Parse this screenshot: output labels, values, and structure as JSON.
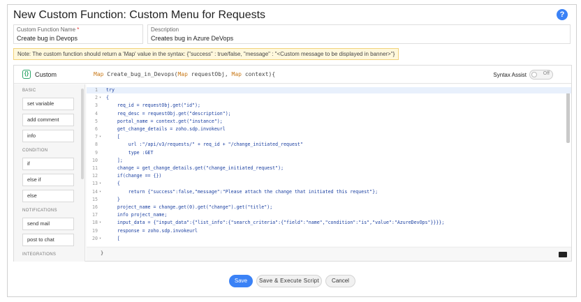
{
  "window": {
    "title": "New Custom Function: Custom Menu for Requests",
    "help_icon": "?"
  },
  "form": {
    "name_label": "Custom Function Name",
    "name_required": "*",
    "name_value": "Create bug in Devops",
    "desc_label": "Description",
    "desc_value": "Creates bug in Azure DeVops"
  },
  "note": "Note: The custom function should return a 'Map' value in the syntax: {\"success\" : true/false, \"message\" : \"<Custom message to be displayed in banner>\"}",
  "editor": {
    "panel_label": "Custom",
    "signature_kw1": "Map",
    "signature_mid": "Create_bug_in_Devops(",
    "signature_kw2": "Map",
    "signature_arg1": "requestObj,",
    "signature_kw3": "Map",
    "signature_arg2": "context){",
    "syntax_assist_label": "Syntax Assist",
    "syntax_toggle": "Off",
    "closing_brace": "}"
  },
  "sidebar": {
    "sections": [
      {
        "label": "BASIC",
        "items": [
          "set variable",
          "add comment",
          "info"
        ]
      },
      {
        "label": "CONDITION",
        "items": [
          "if",
          "else if",
          "else"
        ]
      },
      {
        "label": "NOTIFICATIONS",
        "items": [
          "send mail",
          "post to chat"
        ]
      },
      {
        "label": "INTEGRATIONS",
        "items": []
      }
    ]
  },
  "code": [
    {
      "n": "1",
      "fold": "",
      "text": "try"
    },
    {
      "n": "2",
      "fold": "▾",
      "text": "{"
    },
    {
      "n": "3",
      "fold": "",
      "text": "    req_id = requestObj.get(\"id\");"
    },
    {
      "n": "4",
      "fold": "",
      "text": "    req_desc = requestObj.get(\"description\");"
    },
    {
      "n": "5",
      "fold": "",
      "text": "    portal_name = context.get(\"instance\");"
    },
    {
      "n": "6",
      "fold": "",
      "text": "    get_change_details = zoho.sdp.invokeurl"
    },
    {
      "n": "7",
      "fold": "▾",
      "text": "    ["
    },
    {
      "n": "8",
      "fold": "",
      "text": "        url :\"/api/v3/requests/\" + req_id + \"/change_initiated_request\""
    },
    {
      "n": "9",
      "fold": "",
      "text": "        type :GET"
    },
    {
      "n": "10",
      "fold": "",
      "text": "    ];"
    },
    {
      "n": "11",
      "fold": "",
      "text": "    change = get_change_details.get(\"change_initiated_request\");"
    },
    {
      "n": "12",
      "fold": "",
      "text": "    if(change == {})"
    },
    {
      "n": "13",
      "fold": "▾",
      "text": "    {"
    },
    {
      "n": "14",
      "fold": "▾",
      "text": "        return {\"success\":false,\"message\":\"Please attach the change that initiated this request\"};"
    },
    {
      "n": "15",
      "fold": "",
      "text": "    }"
    },
    {
      "n": "16",
      "fold": "",
      "text": "    project_name = change.get(0).get(\"change\").get(\"title\");"
    },
    {
      "n": "17",
      "fold": "",
      "text": "    info project_name;"
    },
    {
      "n": "18",
      "fold": "▾",
      "text": "    input_data = {\"input_data\":{\"list_info\":{\"search_criteria\":{\"field\":\"name\",\"condition\":\"is\",\"value\":\"AzureDevOps\"}}}};"
    },
    {
      "n": "19",
      "fold": "",
      "text": "    response = zoho.sdp.invokeurl"
    },
    {
      "n": "20",
      "fold": "▾",
      "text": "    ["
    }
  ],
  "footer": {
    "save": "Save",
    "save_execute": "Save & Execute Script",
    "cancel": "Cancel"
  }
}
